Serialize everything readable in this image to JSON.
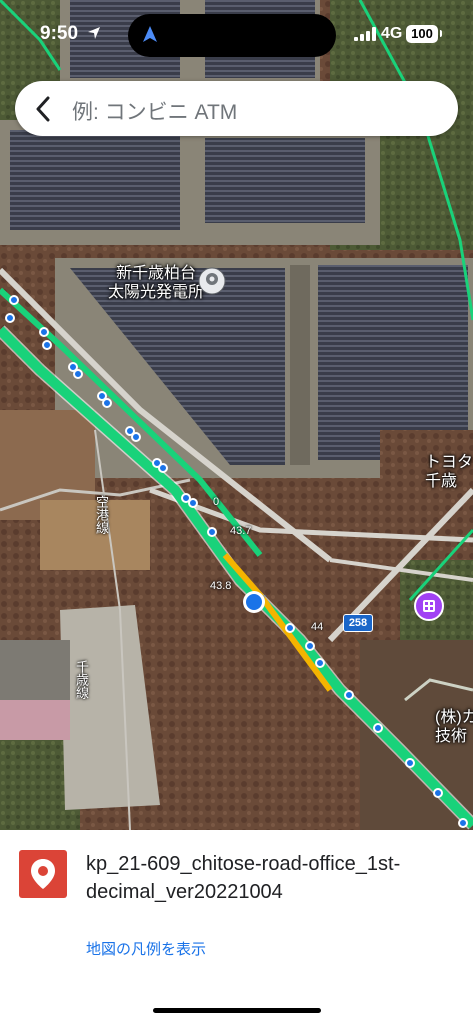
{
  "status_bar": {
    "time": "9:50",
    "network": "4G",
    "battery": "100"
  },
  "search": {
    "placeholder": "例: コンビニ ATM"
  },
  "map": {
    "place_labels": [
      {
        "line1": "新千歳柏台",
        "line2": "太陽光発電所"
      },
      {
        "line1": "トヨタ",
        "line2": "千歳"
      },
      {
        "line1": "(株)カ",
        "line2": "技術"
      }
    ],
    "road_names": [
      "空港線",
      "千歳線"
    ],
    "kp_labels": [
      "0",
      "43.7",
      "43.8",
      "44"
    ],
    "route_shield": "258"
  },
  "sheet": {
    "layer_title": "kp_21-609_chitose-road-office_1st-decimal_ver20221004",
    "legend_link": "地図の凡例を表示"
  },
  "colors": {
    "route_green": "#19d27a",
    "route_yellow": "#f4b400",
    "marker_blue": "#1a73e8",
    "layer_red": "#db4437"
  }
}
